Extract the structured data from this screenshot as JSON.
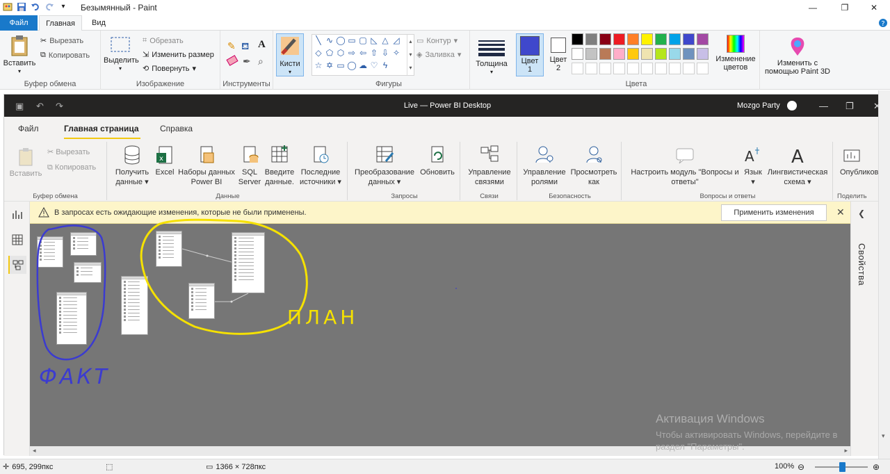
{
  "paint": {
    "title": "Безымянный - Paint",
    "tabs": {
      "file": "Файл",
      "home": "Главная",
      "view": "Вид"
    },
    "clipboard": {
      "paste": "Вставить",
      "cut": "Вырезать",
      "copy": "Копировать",
      "label": "Буфер обмена"
    },
    "image": {
      "select": "Выделить",
      "crop": "Обрезать",
      "resize": "Изменить размер",
      "rotate": "Повернуть",
      "label": "Изображение"
    },
    "tools": {
      "label": "Инструменты"
    },
    "brushes": {
      "label": "Кисти"
    },
    "shapes": {
      "outline": "Контур",
      "fill": "Заливка",
      "label": "Фигуры"
    },
    "size": {
      "label": "Толщина"
    },
    "colors": {
      "color1": "Цвет 1",
      "color2": "Цвет 2",
      "edit": "Изменение цветов",
      "label": "Цвета",
      "color1_value": "#3f48cc",
      "color2_value": "#ffffff",
      "palette": [
        "#000000",
        "#7f7f7f",
        "#880015",
        "#ed1c24",
        "#ff7f27",
        "#fff200",
        "#22b14c",
        "#00a2e8",
        "#3f48cc",
        "#a349a4",
        "#ffffff",
        "#c3c3c3",
        "#b97a57",
        "#ffaec9",
        "#ffc90e",
        "#efe4b0",
        "#b5e61d",
        "#99d9ea",
        "#7092be",
        "#c8bfe7"
      ]
    },
    "paint3d": "Изменить с помощью Paint 3D",
    "status": {
      "cursor": "695, 299пкс",
      "canvas_size": "1366 × 728пкс",
      "zoom": "100%"
    }
  },
  "pbi": {
    "title": "Live — Power BI Desktop",
    "user": "Mozgo Party",
    "tabs": {
      "file": "Файл",
      "home": "Главная страница",
      "help": "Справка"
    },
    "ribbon": {
      "clipboard": {
        "paste": "Вставить",
        "cut": "Вырезать",
        "copy": "Копировать",
        "label": "Буфер обмена"
      },
      "data": {
        "get_data": "Получить данные",
        "excel": "Excel",
        "datasets": "Наборы данных Power BI",
        "sql": "SQL Server",
        "enter": "Введите данные.",
        "recent": "Последние источники",
        "label": "Данные"
      },
      "queries": {
        "transform": "Преобразование данных",
        "refresh": "Обновить",
        "label": "Запросы"
      },
      "relations": {
        "manage": "Управление связями",
        "label": "Связи"
      },
      "security": {
        "manage_roles": "Управление ролями",
        "view_as": "Просмотреть как",
        "label": "Безопасность"
      },
      "qa": {
        "setup": "Настроить модуль \"Вопросы и ответы\"",
        "language": "Язык",
        "schema": "Лингвистическая схема",
        "label": "Вопросы и ответы"
      },
      "share": {
        "publish": "Опубликов",
        "label": "Поделить"
      }
    },
    "warning": {
      "text": "В запросах есть ожидающие изменения, которые не были применены.",
      "apply": "Применить изменения"
    },
    "properties": "Свойства"
  },
  "annotations": {
    "blue_label": "ФАКТ",
    "yellow_label": "ПЛАН"
  },
  "watermark": {
    "title": "Активация Windows",
    "line1": "Чтобы активировать Windows, перейдите в",
    "line2": "раздел \"Параметры\"."
  }
}
